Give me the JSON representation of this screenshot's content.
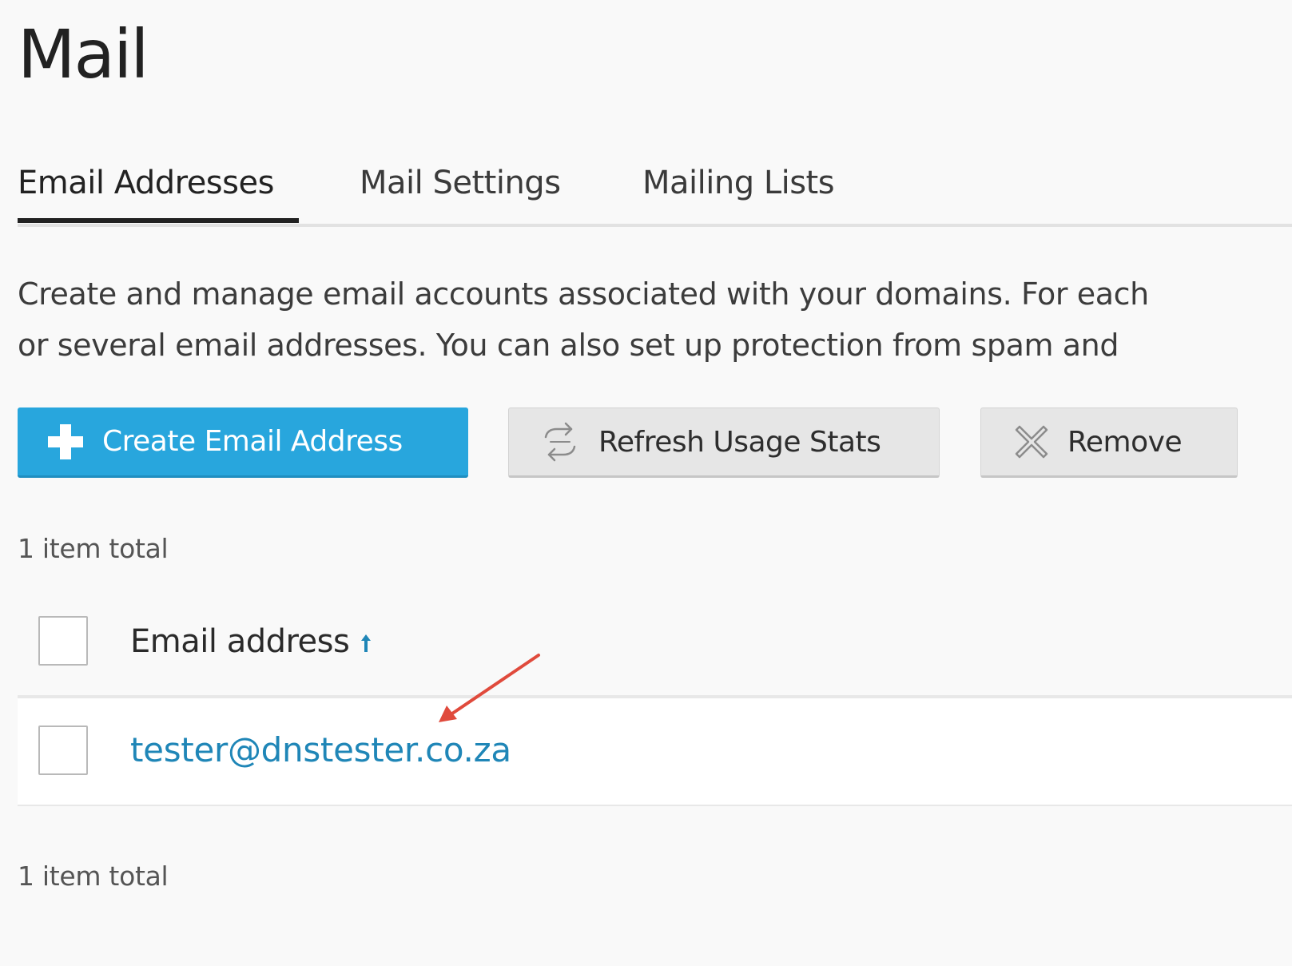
{
  "page": {
    "title": "Mail"
  },
  "tabs": [
    {
      "label": "Email Addresses",
      "active": true
    },
    {
      "label": "Mail Settings",
      "active": false
    },
    {
      "label": "Mailing Lists",
      "active": false
    }
  ],
  "description": {
    "line1": "Create and manage email accounts associated with your domains. For each",
    "line2": "or several email addresses. You can also set up protection from spam and"
  },
  "toolbar": {
    "create_label": "Create Email Address",
    "create_icon": "plus-icon",
    "refresh_label": "Refresh Usage Stats",
    "refresh_icon": "refresh-icon",
    "remove_label": "Remove",
    "remove_icon": "remove-x-icon"
  },
  "list": {
    "total_top": "1 item total",
    "total_bottom": "1 item total",
    "columns": [
      {
        "label": "Email address",
        "sort": "ascending",
        "sort_icon": "sort-arrow-up-icon"
      }
    ],
    "rows": [
      {
        "email": "tester@dnstester.co.za",
        "selected": false
      }
    ]
  },
  "annotation": {
    "type": "arrow",
    "color": "#e04a3c",
    "points_to": "tester@dnstester.co.za"
  },
  "colors": {
    "primary": "#28a6dd",
    "link": "#1f86b7",
    "sort_icon": "#1f86b7",
    "background": "#f9f9f9"
  }
}
